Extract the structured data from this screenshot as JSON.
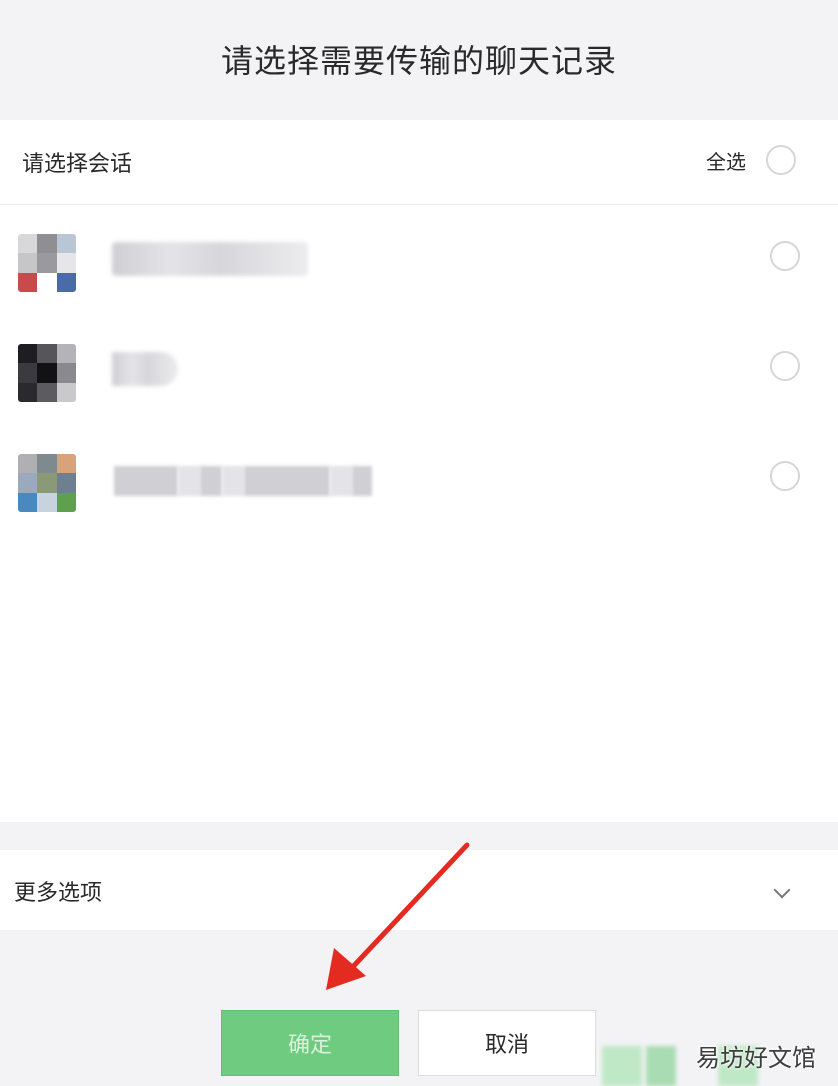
{
  "dialog": {
    "title": "请选择需要传输的聊天记录"
  },
  "selection": {
    "label": "请选择会话",
    "select_all_label": "全选"
  },
  "more_options": {
    "label": "更多选项"
  },
  "buttons": {
    "confirm_label": "确定",
    "cancel_label": "取消"
  },
  "watermark": {
    "text": "易坊好文馆"
  },
  "colors": {
    "accent": "#6fcb7f",
    "arrow": "#e32b22",
    "background": "#f3f3f5"
  }
}
